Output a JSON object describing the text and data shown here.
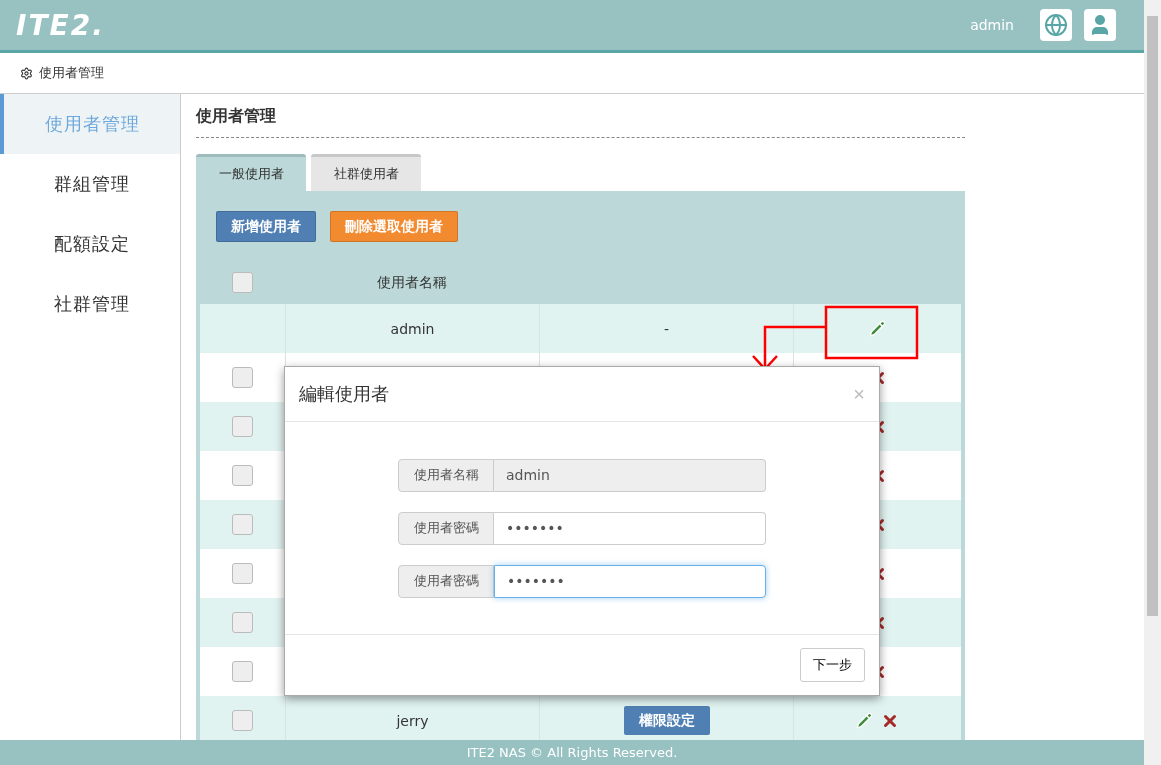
{
  "header": {
    "logo": "ITE2.",
    "user": "admin"
  },
  "breadcrumb": {
    "label": "使用者管理"
  },
  "sidebar": {
    "items": [
      {
        "label": "使用者管理",
        "selected": true
      },
      {
        "label": "群組管理",
        "selected": false
      },
      {
        "label": "配額設定",
        "selected": false
      },
      {
        "label": "社群管理",
        "selected": false
      }
    ]
  },
  "page_title": "使用者管理",
  "tabs": [
    {
      "label": "一般使用者",
      "selected": true
    },
    {
      "label": "社群使用者",
      "selected": false
    }
  ],
  "actions": [
    {
      "label": "新增使用者",
      "kind": "primary"
    },
    {
      "label": "刪除選取使用者",
      "kind": "warning"
    }
  ],
  "table": {
    "header_checked": false,
    "columns": [
      "使用者名稱"
    ],
    "rows": [
      {
        "kind": "owner",
        "name": "admin",
        "permission": "-"
      },
      {
        "kind": "covered",
        "checked": false
      },
      {
        "kind": "covered",
        "checked": false
      },
      {
        "kind": "covered",
        "checked": false
      },
      {
        "kind": "covered",
        "checked": false
      },
      {
        "kind": "covered",
        "checked": false
      },
      {
        "kind": "covered",
        "checked": false
      },
      {
        "kind": "covered",
        "checked": false
      },
      {
        "kind": "user",
        "checked": false,
        "name": "jerry",
        "permission": "權限設定"
      }
    ]
  },
  "modal": {
    "title": "編輯使用者",
    "close": "×",
    "fields": [
      {
        "label": "使用者名稱",
        "value": "admin",
        "disabled": true,
        "focused": false
      },
      {
        "label": "使用者密碼",
        "value": "•••••••",
        "disabled": false,
        "focused": false
      },
      {
        "label": "使用者密碼",
        "value": "•••••••",
        "disabled": false,
        "focused": true
      }
    ],
    "button": "下一步"
  },
  "footer": "ITE2 NAS © All Rights Reserved."
}
